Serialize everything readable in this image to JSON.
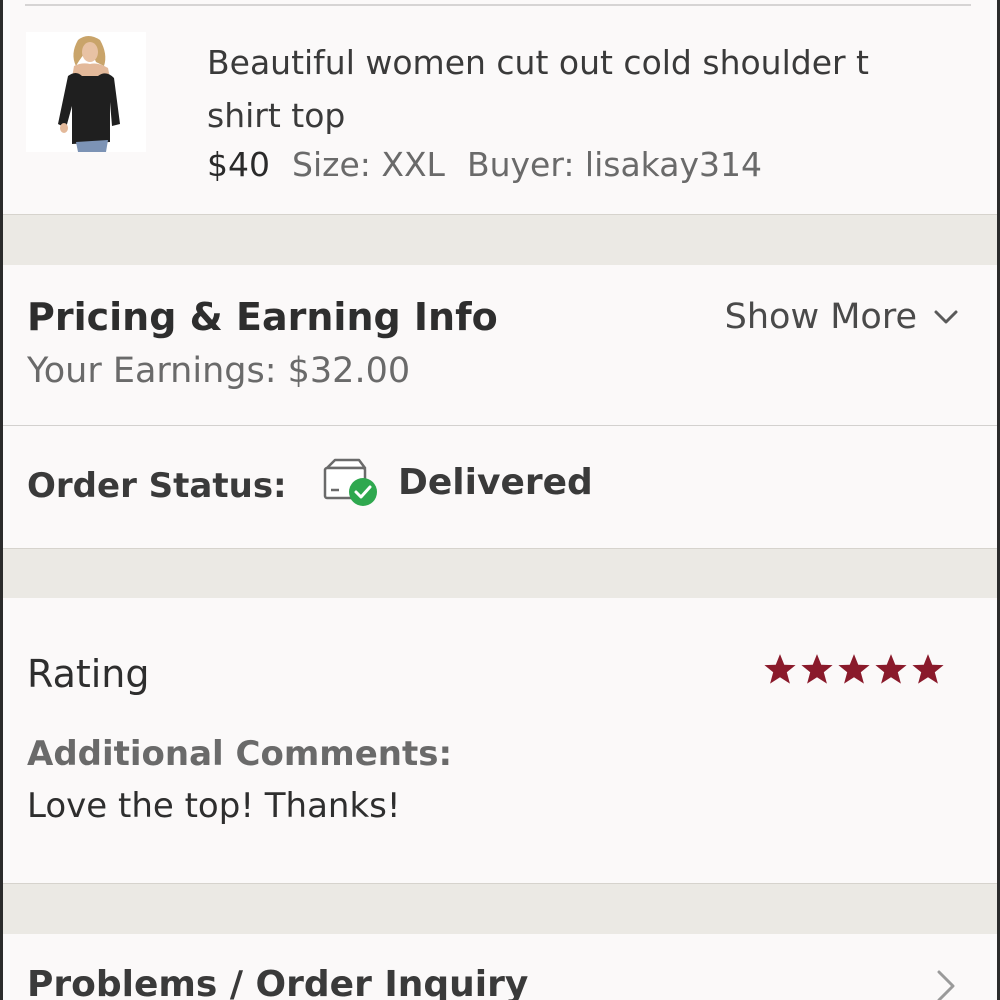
{
  "product": {
    "title": "Beautiful women cut out cold shoulder t shirt top",
    "price": "$40",
    "size": "Size: XXL",
    "buyer": "Buyer: lisakay314"
  },
  "pricing": {
    "heading": "Pricing & Earning Info",
    "earnings": "Your Earnings: $32.00",
    "show_more": "Show More"
  },
  "order_status": {
    "label": "Order Status:",
    "value": "Delivered",
    "icon": "delivered-box-icon"
  },
  "rating": {
    "heading": "Rating",
    "stars": 5,
    "max_stars": 5,
    "star_color": "#8a1a2b",
    "comments_label": "Additional Comments:",
    "comments": "Love the top! Thanks!"
  },
  "inquiry": {
    "heading": "Problems / Order Inquiry"
  },
  "colors": {
    "status_check": "#2fa84f",
    "band": "#ebe9e4"
  }
}
